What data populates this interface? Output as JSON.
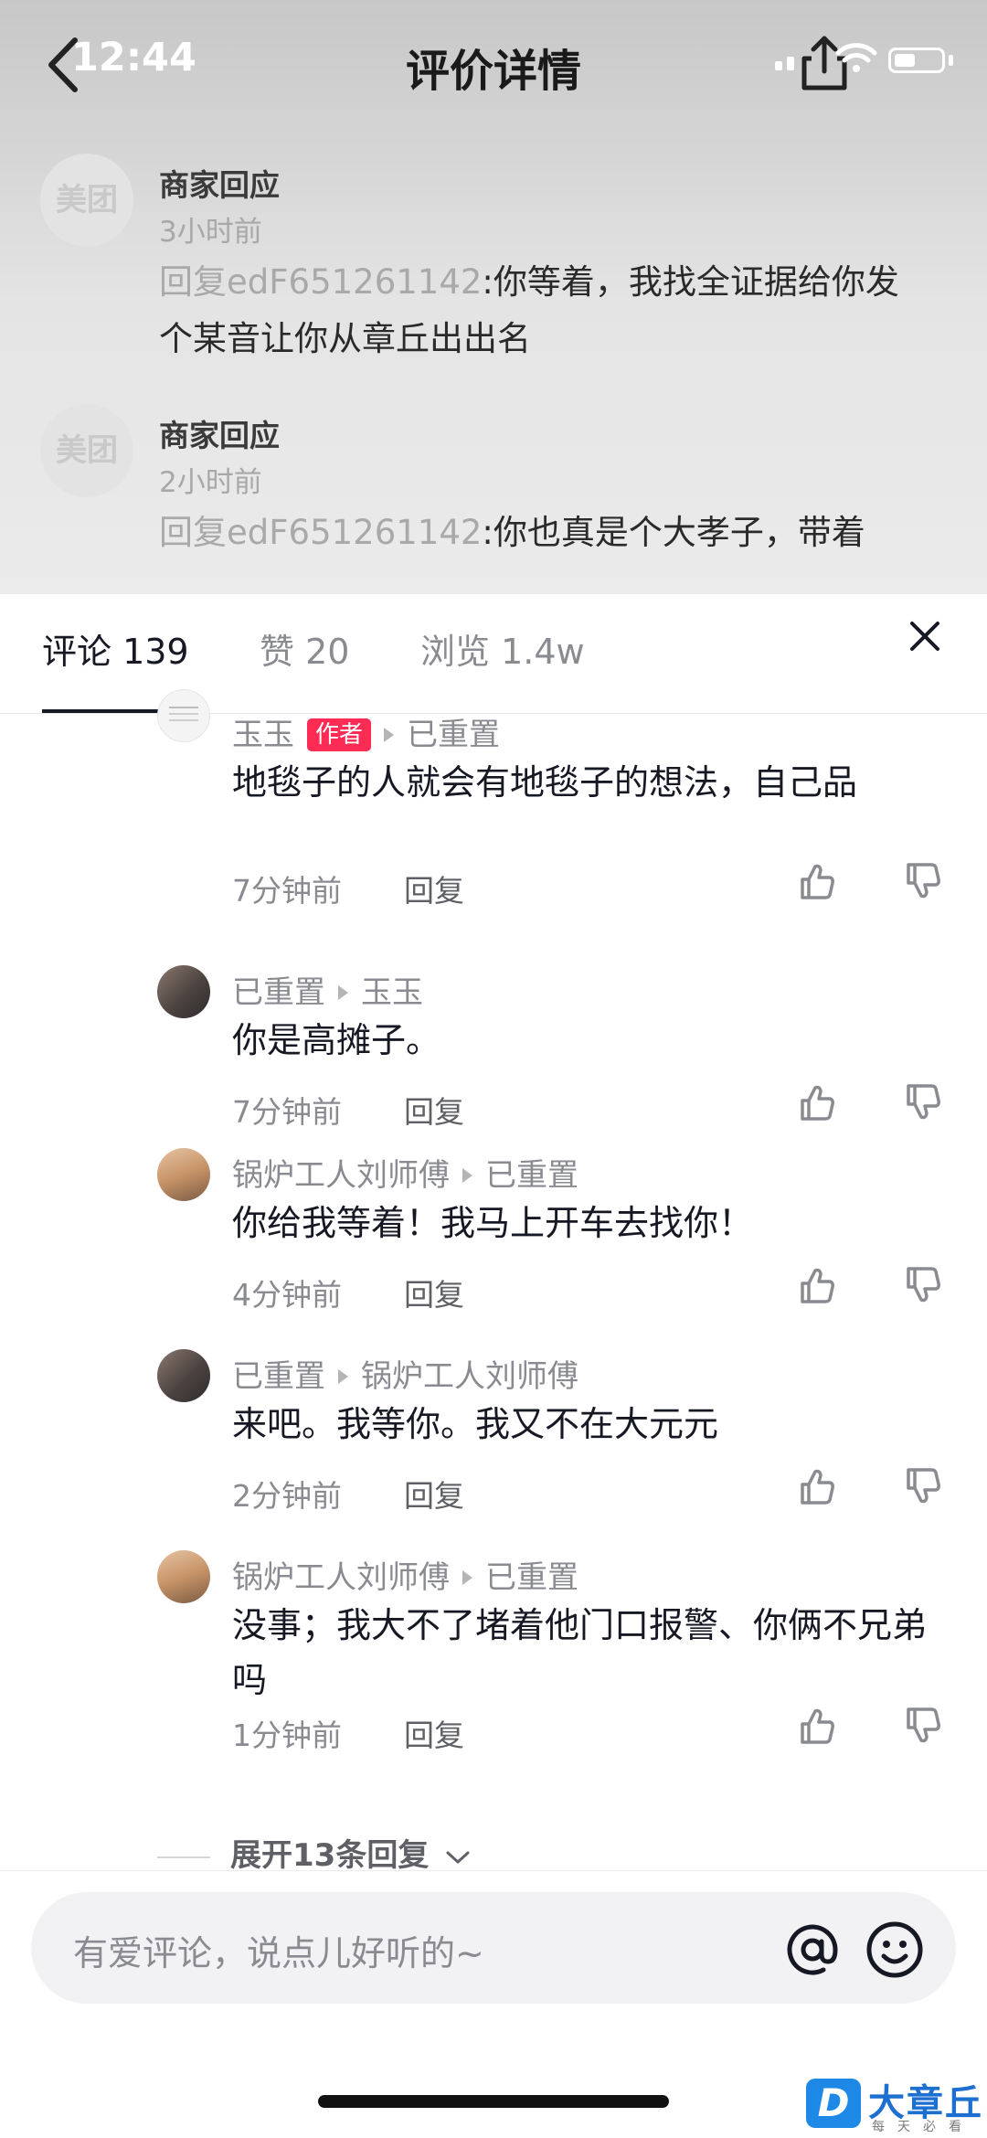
{
  "status": {
    "time": "12:44"
  },
  "header": {
    "title": "评价详情"
  },
  "background_replies": [
    {
      "avatar_text": "美团",
      "name": "商家回应",
      "time": "3小时前",
      "reply_prefix": "回复edF651261142",
      "reply_text": ":你等着，我找全证据给你发个某音让你从章丘出出名"
    },
    {
      "avatar_text": "美团",
      "name": "商家回应",
      "time": "2小时前",
      "reply_prefix": "回复edF651261142",
      "reply_text": ":你也真是个大孝子，带着"
    }
  ],
  "tabs": [
    {
      "label": "评论 139",
      "active": true
    },
    {
      "label": "赞 20",
      "active": false
    },
    {
      "label": "浏览 1.4w",
      "active": false
    }
  ],
  "comments": [
    {
      "author": "玉玉",
      "author_badge": "作者",
      "reply_to": "已重置",
      "text": "地毯子的人就会有地毯子的想法，自己品",
      "time": "7分钟前",
      "reply_label": "回复"
    },
    {
      "author": "已重置",
      "reply_to": "玉玉",
      "text": "你是高摊子。",
      "time": "7分钟前",
      "reply_label": "回复"
    },
    {
      "author": "锅炉工人刘师傅",
      "reply_to": "已重置",
      "text": "你给我等着！我马上开车去找你！",
      "time": "4分钟前",
      "reply_label": "回复"
    },
    {
      "author": "已重置",
      "reply_to": "锅炉工人刘师傅",
      "text": "来吧。我等你。我又不在大元元",
      "time": "2分钟前",
      "reply_label": "回复"
    },
    {
      "author": "锅炉工人刘师傅",
      "reply_to": "已重置",
      "text": "没事；我大不了堵着他门口报警、你俩不兄弟吗",
      "time": "1分钟前",
      "reply_label": "回复"
    }
  ],
  "expand": {
    "label": "展开13条回复"
  },
  "input": {
    "placeholder": "有爱评论，说点儿好听的~"
  },
  "watermark": {
    "logo_letter": "D",
    "name": "大章丘",
    "sub": "每天必看"
  },
  "colors": {
    "accent": "#fe2c55",
    "text": "#161823",
    "secondary": "#8a8b91"
  }
}
